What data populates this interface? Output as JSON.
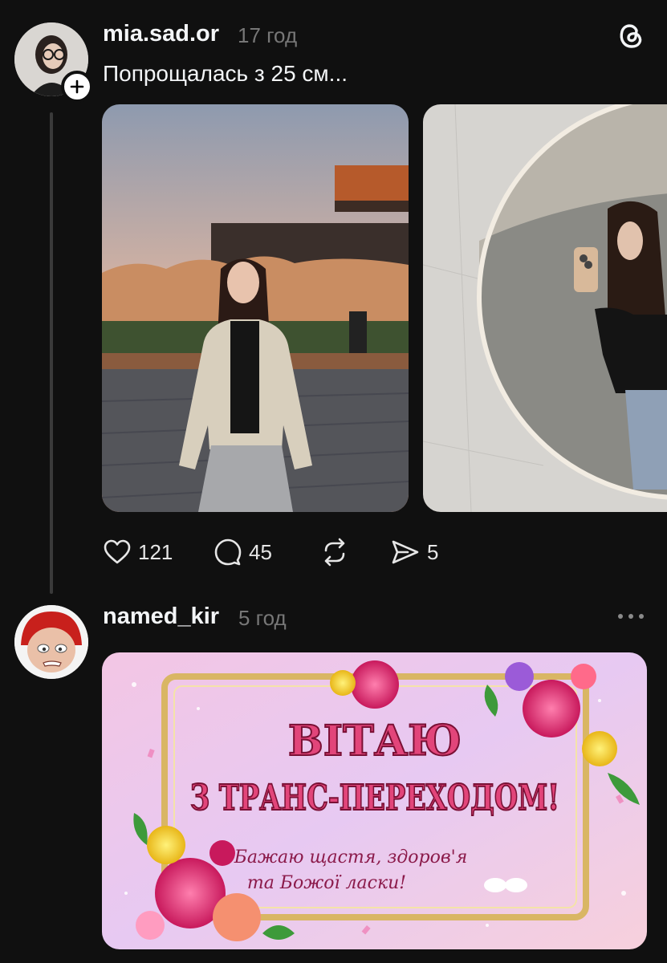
{
  "post1": {
    "username": "mia.sad.or",
    "time": "17 год",
    "caption": "Попрощалась з 25 см...",
    "actions": {
      "likes": "121",
      "comments": "45",
      "shares": "5"
    }
  },
  "post2": {
    "username": "named_kir",
    "time": "5 год",
    "banner": {
      "line1": "ВІТАЮ",
      "line2": "З ТРАНС-ПЕРЕХОДОМ!",
      "line3": "Бажаю щастя, здоров'я",
      "line4": "та Божої ласки!"
    }
  },
  "colors": {
    "background": "#101010",
    "text": "#f3f5f7",
    "muted": "#777777",
    "banner_title": "#e2457a"
  }
}
